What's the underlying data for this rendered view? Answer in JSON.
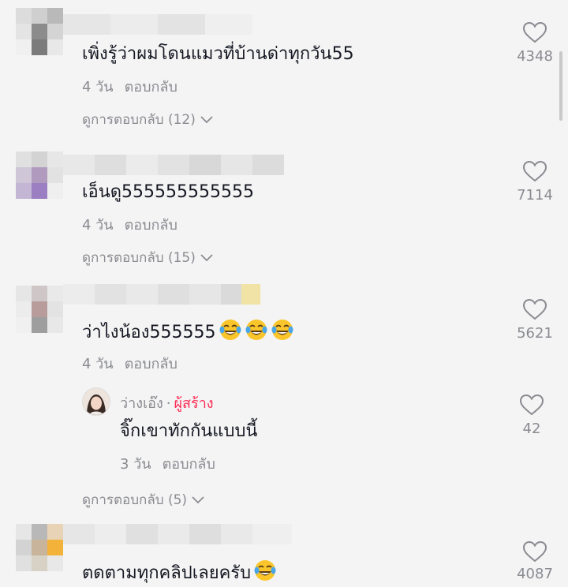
{
  "comments": [
    {
      "text": "เพิ่งรู้ว่าผมโดนแมวที่บ้านด่าทุกวัน55",
      "time": "4 วัน",
      "reply_label": "ตอบกลับ",
      "view_replies": "ดูการตอบกลับ (12)",
      "likes": "4348"
    },
    {
      "text": "เอ็นดู555555555555",
      "time": "4 วัน",
      "reply_label": "ตอบกลับ",
      "view_replies": "ดูการตอบกลับ (15)",
      "likes": "7114"
    },
    {
      "text": "ว่าไงน้อง555555",
      "time": "4 วัน",
      "reply_label": "ตอบกลับ",
      "view_replies": "ดูการตอบกลับ (5)",
      "likes": "5621",
      "emoji_count": 3,
      "reply": {
        "author": "ว่างเอ๊ง",
        "separator": "·",
        "creator_badge": "ผู้สร้าง",
        "text": "จิ๊กเขาทักกันแบบนี้",
        "time": "3 วัน",
        "reply_label": "ตอบกลับ",
        "likes": "42"
      }
    },
    {
      "text": "ตดตามทุกคลิปเลยครับ",
      "likes": "4087",
      "emoji_count": 1
    }
  ],
  "icons": {
    "like": "heart-outline-icon",
    "expand": "chevron-down-icon",
    "emoji": "face-with-tears-of-joy-icon"
  },
  "colors": {
    "background": "#f4f4f4",
    "text": "#161823",
    "muted": "#8a8b91",
    "creator": "#fe2c55"
  }
}
